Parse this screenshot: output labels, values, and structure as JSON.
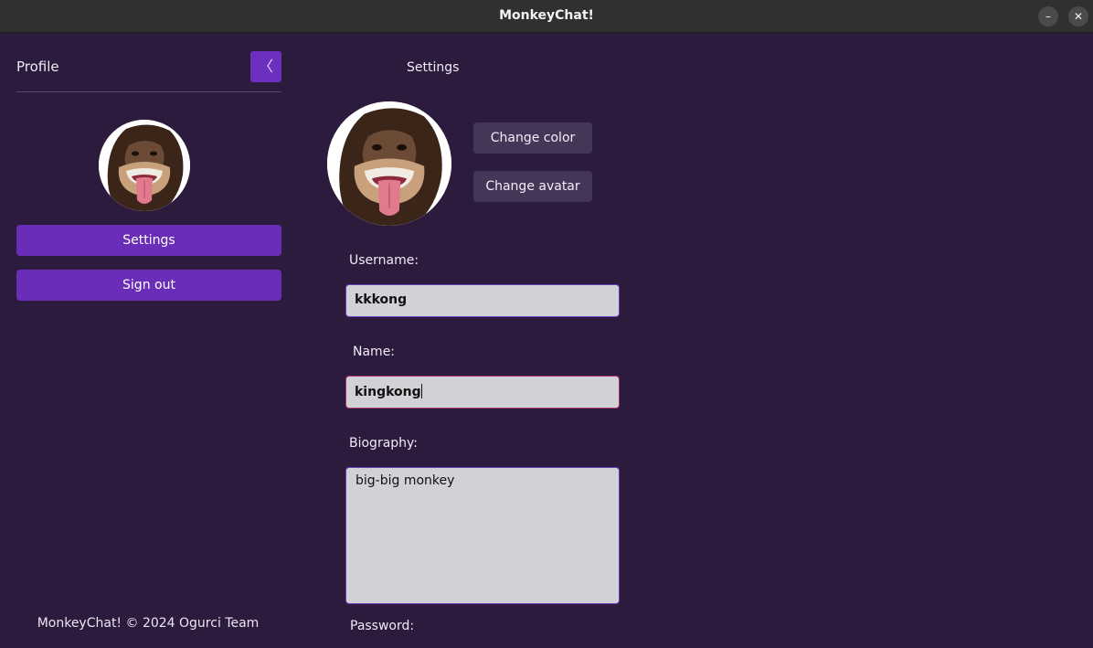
{
  "window": {
    "title": "MonkeyChat!",
    "minimize_glyph": "–",
    "close_glyph": "✕"
  },
  "sidebar": {
    "title": "Profile",
    "collapse_glyph": "〈",
    "settings_label": "Settings",
    "signout_label": "Sign out",
    "footer": "MonkeyChat! © 2024 Ogurci Team"
  },
  "settings": {
    "title": "Settings",
    "change_color_label": "Change color",
    "change_avatar_label": "Change avatar",
    "username_label": "Username:",
    "username_value": "kkkong",
    "name_label": "Name:",
    "name_value": "kingkong",
    "bio_label": "Biography:",
    "bio_value": "big-big monkey",
    "password_label": "Password:"
  },
  "icons": {
    "collapse": "chevron-left-icon",
    "minimize": "minimize-icon",
    "close": "close-icon"
  },
  "colors": {
    "background": "#2d1b3e",
    "accent": "#6a2db8",
    "secondary_button": "#443656",
    "input_background": "#d0d2d6",
    "input_border": "#6a3dc0",
    "focus_border": "#b03070"
  }
}
